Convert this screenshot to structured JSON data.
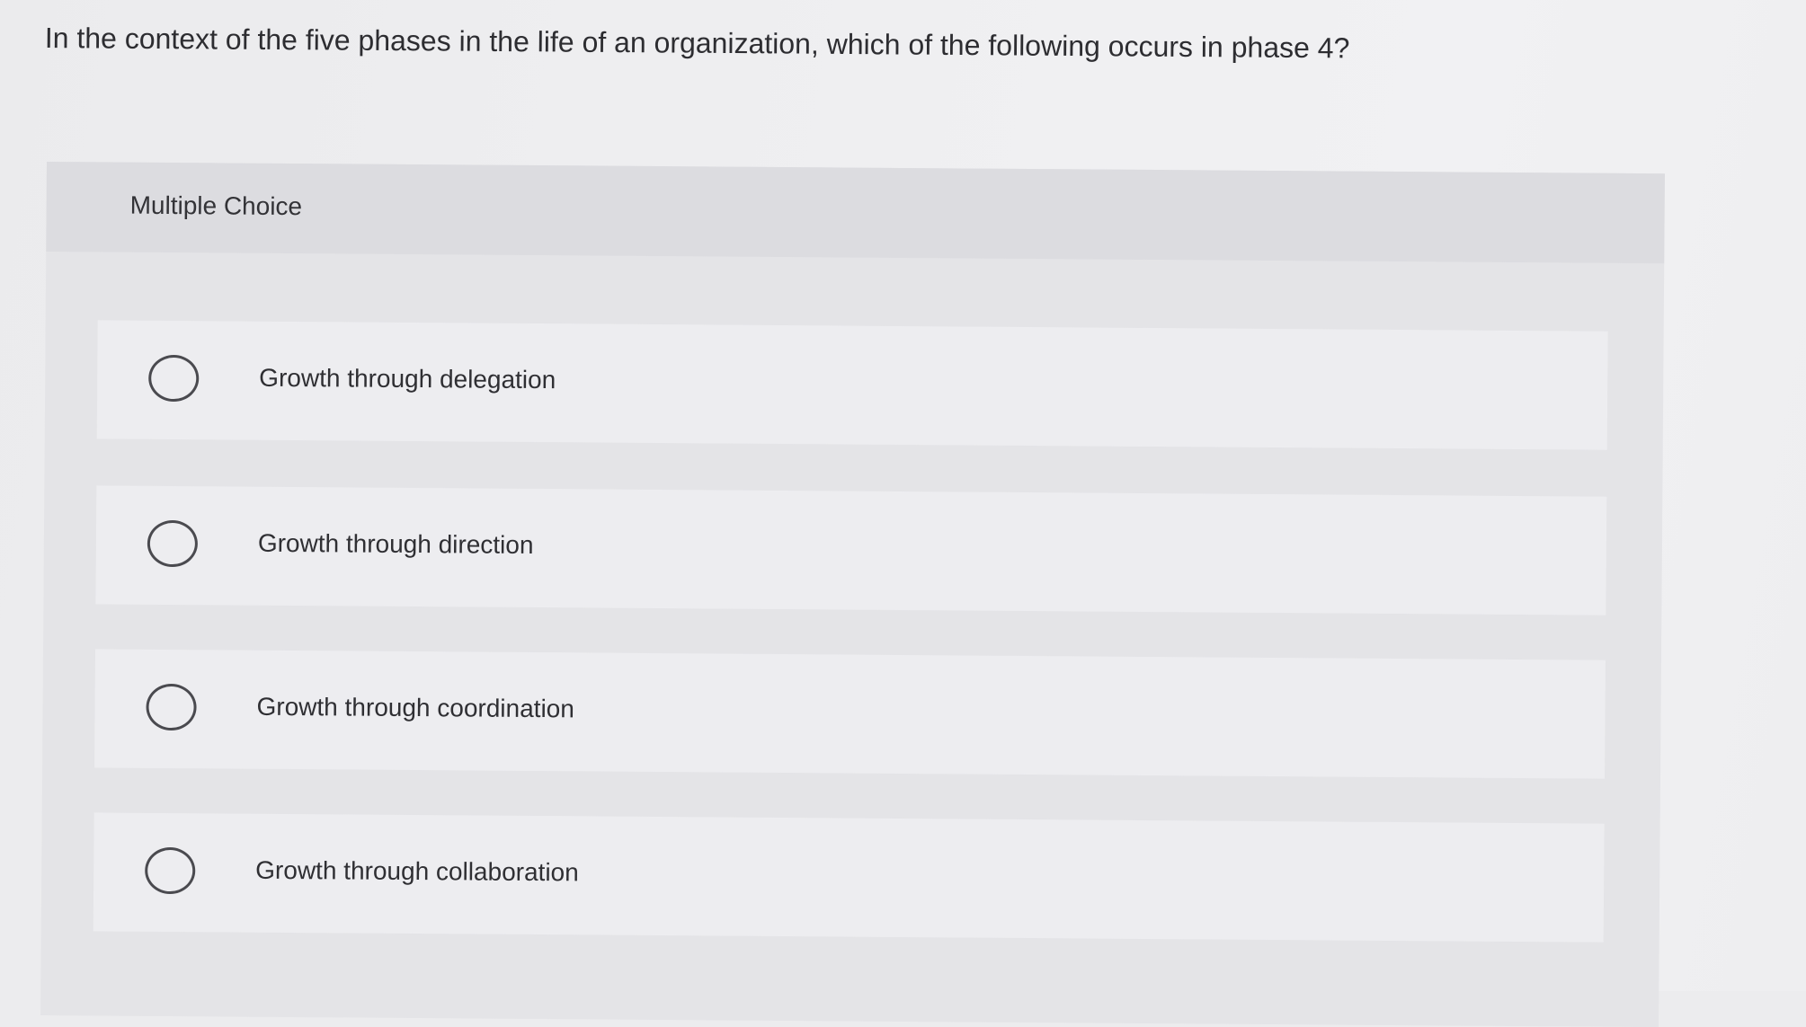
{
  "question": {
    "text": "In the context of the five phases in the life of an organization, which of the following occurs in phase 4?"
  },
  "panel": {
    "label": "Multiple Choice"
  },
  "options": [
    {
      "label": "Growth through delegation"
    },
    {
      "label": "Growth through direction"
    },
    {
      "label": "Growth through coordination"
    },
    {
      "label": "Growth through collaboration"
    }
  ],
  "colors": {
    "background": "#ececee",
    "panel": "#e4e4e7",
    "option_card": "#ededf0",
    "text": "#2d2d31",
    "radio_border": "#4a4a4f"
  }
}
